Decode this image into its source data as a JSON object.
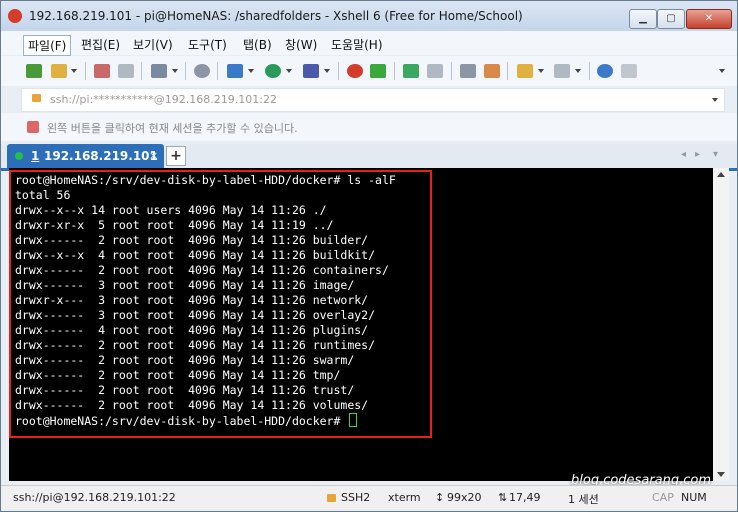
{
  "window": {
    "title": "192.168.219.101 - pi@HomeNAS: /sharedfolders - Xshell 6 (Free for Home/School)",
    "min_label": "▁",
    "max_label": "▢",
    "close_label": "✕"
  },
  "menu": {
    "items": [
      "파일(F)",
      "편집(E)",
      "보기(V)",
      "도구(T)",
      "탭(B)",
      "창(W)",
      "도움말(H)"
    ]
  },
  "toolbar": {
    "icons": [
      "new-session-icon",
      "open-folder-icon",
      "reconnect-icon",
      "disconnect-icon",
      "properties-icon",
      "find-icon",
      "transfer-icon",
      "globe-icon",
      "font-icon",
      "xshell-icon",
      "xftp-icon",
      "fullscreen-icon",
      "lock-icon",
      "keyboard-icon",
      "highlight-icon",
      "new-tab-icon",
      "layout-icon",
      "help-icon",
      "chat-icon"
    ]
  },
  "address": {
    "placeholder": "ssh://pi:***********@192.168.219.101:22"
  },
  "hint": {
    "text": "왼쪽 버튼을 클릭하여 현재 세션을 추가할 수 있습니다."
  },
  "tabs": [
    {
      "num": "1",
      "label": "192.168.219.101",
      "close": "×"
    }
  ],
  "tab_add_label": "+",
  "tab_nav": {
    "prev": "◂",
    "next": "▸",
    "list": "▾"
  },
  "terminal": {
    "lines": [
      "root@HomeNAS:/srv/dev-disk-by-label-HDD/docker# ls -alF",
      "total 56",
      "drwx--x--x 14 root users 4096 May 14 11:26 ./",
      "drwxr-xr-x  5 root root  4096 May 14 11:19 ../",
      "drwx------  2 root root  4096 May 14 11:26 builder/",
      "drwx--x--x  4 root root  4096 May 14 11:26 buildkit/",
      "drwx------  2 root root  4096 May 14 11:26 containers/",
      "drwx------  3 root root  4096 May 14 11:26 image/",
      "drwxr-x---  3 root root  4096 May 14 11:26 network/",
      "drwx------  3 root root  4096 May 14 11:26 overlay2/",
      "drwx------  4 root root  4096 May 14 11:26 plugins/",
      "drwx------  2 root root  4096 May 14 11:26 runtimes/",
      "drwx------  2 root root  4096 May 14 11:26 swarm/",
      "drwx------  2 root root  4096 May 14 11:26 tmp/",
      "drwx------  2 root root  4096 May 14 11:26 trust/",
      "drwx------  2 root root  4096 May 14 11:26 volumes/"
    ],
    "prompt": "root@HomeNAS:/srv/dev-disk-by-label-HDD/docker# "
  },
  "watermark": "blog.codesarang.com",
  "status": {
    "connection": "ssh://pi@192.168.219.101:22",
    "protocol": "SSH2",
    "term": "xterm",
    "size": "99x20",
    "position": "17,49",
    "sessions": "1 세션",
    "cap": "CAP",
    "num": "NUM"
  },
  "colors": {
    "tab_active": "#2c6fb8",
    "terminal_bg": "#000000",
    "highlight_border": "#e8201c",
    "cursor": "#2cd84a"
  }
}
